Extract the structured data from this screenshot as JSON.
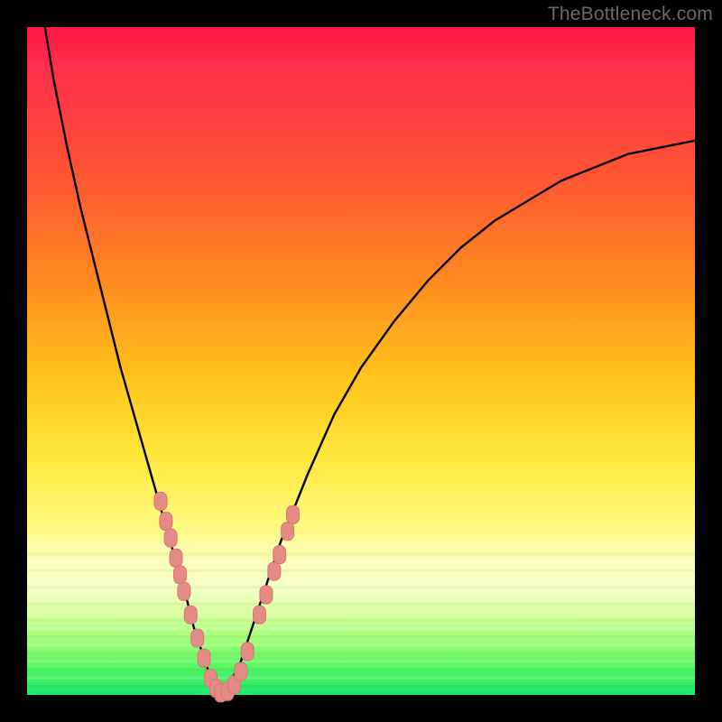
{
  "watermark": "TheBottleneck.com",
  "colors": {
    "frame": "#000000",
    "curve": "#000000",
    "marker_fill": "#e48b85",
    "marker_stroke": "#d77671"
  },
  "chart_data": {
    "type": "line",
    "title": "",
    "xlabel": "",
    "ylabel": "",
    "xlim": [
      0,
      100
    ],
    "ylim": [
      0,
      100
    ],
    "curve_minimum_x": 29,
    "series": [
      {
        "name": "bottleneck-curve",
        "x": [
          0,
          2,
          4,
          6,
          8,
          10,
          12,
          14,
          16,
          18,
          20,
          22,
          24,
          25,
          26,
          27,
          28,
          29,
          30,
          31,
          32,
          33,
          34,
          36,
          38,
          40,
          42,
          46,
          50,
          55,
          60,
          65,
          70,
          75,
          80,
          85,
          90,
          95,
          100
        ],
        "y": [
          120,
          104,
          92,
          82,
          73,
          65,
          57,
          49,
          42,
          35,
          28,
          21,
          14,
          10,
          7,
          4,
          2,
          0,
          1,
          3,
          5,
          8,
          11,
          17,
          23,
          28,
          33,
          42,
          49,
          56,
          62,
          67,
          71,
          74,
          77,
          79,
          81,
          82,
          83
        ]
      }
    ],
    "markers": {
      "name": "highlighted-points",
      "points": [
        {
          "x": 20.0,
          "y": 29
        },
        {
          "x": 20.8,
          "y": 26
        },
        {
          "x": 21.5,
          "y": 23.5
        },
        {
          "x": 22.3,
          "y": 20.5
        },
        {
          "x": 22.9,
          "y": 18
        },
        {
          "x": 23.5,
          "y": 15.5
        },
        {
          "x": 24.5,
          "y": 12
        },
        {
          "x": 25.5,
          "y": 8.5
        },
        {
          "x": 26.5,
          "y": 5.5
        },
        {
          "x": 27.5,
          "y": 2.5
        },
        {
          "x": 28.3,
          "y": 1.0
        },
        {
          "x": 29.0,
          "y": 0.3
        },
        {
          "x": 30.0,
          "y": 0.5
        },
        {
          "x": 31.0,
          "y": 1.5
        },
        {
          "x": 32.0,
          "y": 3.5
        },
        {
          "x": 33.0,
          "y": 6.5
        },
        {
          "x": 34.8,
          "y": 12
        },
        {
          "x": 35.8,
          "y": 15
        },
        {
          "x": 37.0,
          "y": 18.5
        },
        {
          "x": 37.8,
          "y": 21
        },
        {
          "x": 39.0,
          "y": 24.5
        },
        {
          "x": 39.8,
          "y": 27
        }
      ]
    }
  }
}
